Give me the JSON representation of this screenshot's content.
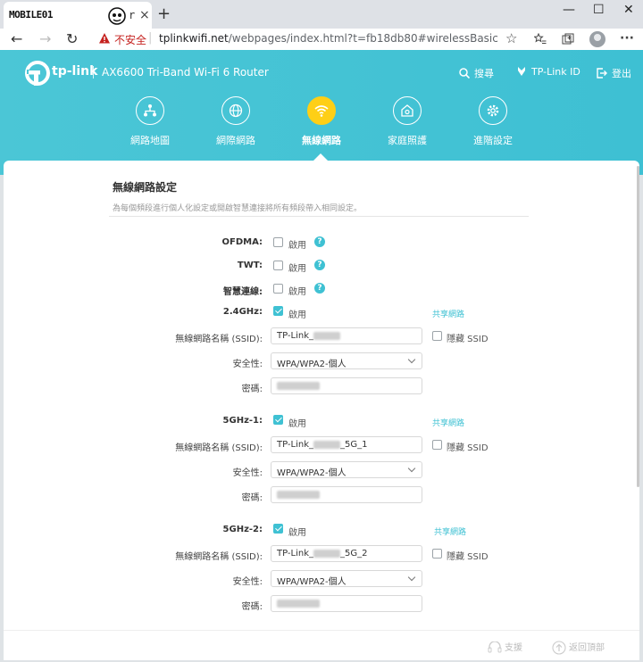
{
  "browser": {
    "tab_logo": "MOBILE01",
    "tab_title": "r",
    "tab_close": "×",
    "new_tab": "+",
    "window": {
      "minimize": "—",
      "maximize": "☐",
      "close": "✕"
    },
    "back": "←",
    "forward": "→",
    "reload": "↻",
    "security_label": "不安全",
    "url_host": "tplinkwifi.net",
    "url_path": "/webpages/index.html?t=fb18db80#wirelessBasic",
    "star": "☆"
  },
  "header": {
    "brand": "tp-link",
    "model": "AX6600 Tri-Band Wi-Fi 6 Router",
    "search_label": "搜尋",
    "tplink_id_label": "TP-Link ID",
    "logout_label": "登出"
  },
  "nav": [
    {
      "label": "網路地圖",
      "icon": "network-map-icon",
      "active": false
    },
    {
      "label": "網際網路",
      "icon": "globe-icon",
      "active": false
    },
    {
      "label": "無線網路",
      "icon": "wifi-icon",
      "active": true
    },
    {
      "label": "家庭照護",
      "icon": "home-care-icon",
      "active": false
    },
    {
      "label": "進階設定",
      "icon": "gear-icon",
      "active": false
    }
  ],
  "section": {
    "title": "無線網路設定",
    "description": "為每個頻段進行個人化設定或開啟智慧連接將所有頻段帶入相同設定。"
  },
  "options": {
    "ofdma": {
      "label": "OFDMA:",
      "enable": "啟用",
      "checked": false
    },
    "twt": {
      "label": "TWT:",
      "enable": "啟用",
      "checked": false
    },
    "smart_connect": {
      "label": "智慧連線:",
      "enable": "啟用",
      "checked": false
    }
  },
  "bands": [
    {
      "label": "2.4GHz:",
      "enable": "啟用",
      "checked": true,
      "share": "共享網路",
      "ssid_label": "無線網路名稱 (SSID):",
      "ssid_prefix": "TP-Link_",
      "ssid_suffix": "",
      "hide_ssid": "隱藏 SSID",
      "security_label": "安全性:",
      "security_value": "WPA/WPA2-個人",
      "password_label": "密碼:"
    },
    {
      "label": "5GHz-1:",
      "enable": "啟用",
      "checked": true,
      "share": "共享網路",
      "ssid_label": "無線網路名稱 (SSID):",
      "ssid_prefix": "TP-Link_",
      "ssid_suffix": "_5G_1",
      "hide_ssid": "隱藏 SSID",
      "security_label": "安全性:",
      "security_value": "WPA/WPA2-個人",
      "password_label": "密碼:"
    },
    {
      "label": "5GHz-2:",
      "enable": "啟用",
      "checked": true,
      "share": "共享網路",
      "ssid_label": "無線網路名稱 (SSID):",
      "ssid_prefix": "TP-Link_",
      "ssid_suffix": "_5G_2",
      "hide_ssid": "隱藏 SSID",
      "security_label": "安全性:",
      "security_value": "WPA/WPA2-個人",
      "password_label": "密碼:"
    }
  ],
  "footer": {
    "support_label": "支援",
    "back_to_top_label": "返回頂部"
  },
  "colors": {
    "header_teal": "#45c3d5",
    "accent": "#3fc1d3",
    "active_nav": "#fecf16",
    "warning_red": "#c5221f"
  }
}
